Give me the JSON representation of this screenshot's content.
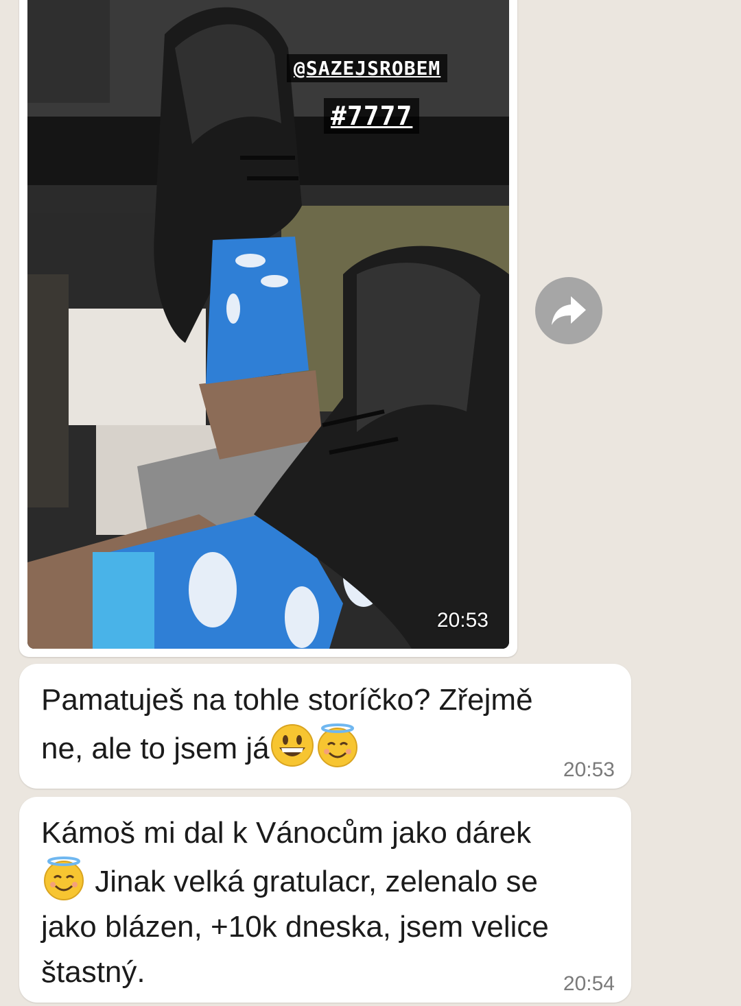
{
  "image_message": {
    "overlay_handle": "@SAZEJSROBEM",
    "overlay_hashtag": "#7777",
    "time": "20:53",
    "photo_subject": "black-shoes-blue-socks-photo"
  },
  "forward_icon": "forward-arrow-icon",
  "messages": [
    {
      "line1": "Pamatuješ na tohle storíčko? Zřejmě",
      "line2": "ne, ale to jsem já",
      "emojis": [
        "grinning-face-emoji",
        "smiling-face-with-halo-emoji"
      ],
      "time": "20:53"
    },
    {
      "line1": "Kámoš mi dal k Vánocům jako dárek",
      "line2": " Jinak velká gratulacr, zelenalo se",
      "line3": "jako blázen, +10k dneska, jsem velice",
      "line4": "štastný.",
      "emojis": [
        "smiling-face-with-halo-emoji"
      ],
      "time": "20:54"
    }
  ],
  "colors": {
    "chat_background": "#ebe6df",
    "bubble": "#ffffff",
    "timestamp": "#7a7a7a",
    "forward_button": "#a6a6a6",
    "sock_blue": "#2f7fd6"
  }
}
